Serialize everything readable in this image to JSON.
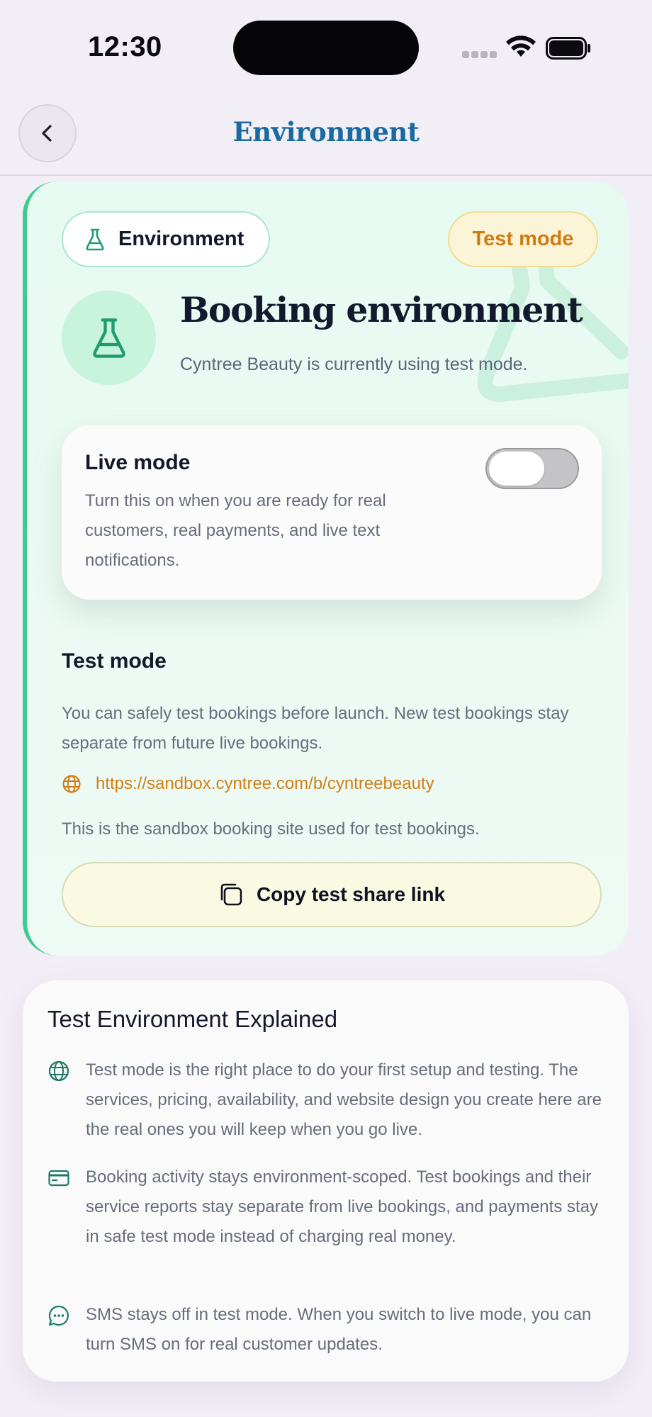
{
  "status_bar": {
    "time": "12:30"
  },
  "header": {
    "title": "Environment"
  },
  "environment_card": {
    "environment_pill": "Environment",
    "mode_pill": "Test mode",
    "heading": "Booking environment",
    "subtitle": "Cyntree Beauty is currently using test mode.",
    "live_mode": {
      "title": "Live mode",
      "description": "Turn this on when you are ready for real customers, real payments, and live text notifications.",
      "enabled": false
    },
    "test_mode": {
      "title": "Test mode",
      "description": "You can safely test bookings before launch. New test bookings stay separate from future live bookings.",
      "sandbox_url": "https://sandbox.cyntree.com/b/cyntreebeauty",
      "sandbox_note": "This is the sandbox booking site used for test bookings.",
      "copy_button": "Copy test share link"
    }
  },
  "info_card": {
    "title": "Test Environment Explained",
    "items": [
      {
        "icon": "globe-icon",
        "text": "Test mode is the right place to do your first setup and testing. The services, pricing, availability, and website design you create here are the real ones you will keep when you go live."
      },
      {
        "icon": "credit-card-icon",
        "text": "Booking activity stays environment-scoped. Test bookings and their service reports stay separate from live bookings, and payments stay in safe test mode instead of charging real money."
      },
      {
        "icon": "chat-bubble-icon",
        "text": "SMS stays off in test mode. When you switch to live mode, you can turn SMS on for real customer updates."
      }
    ]
  },
  "colors": {
    "accent_blue": "#1a6aa0",
    "accent_green": "#3ecb91",
    "test_orange": "#d17c12"
  }
}
